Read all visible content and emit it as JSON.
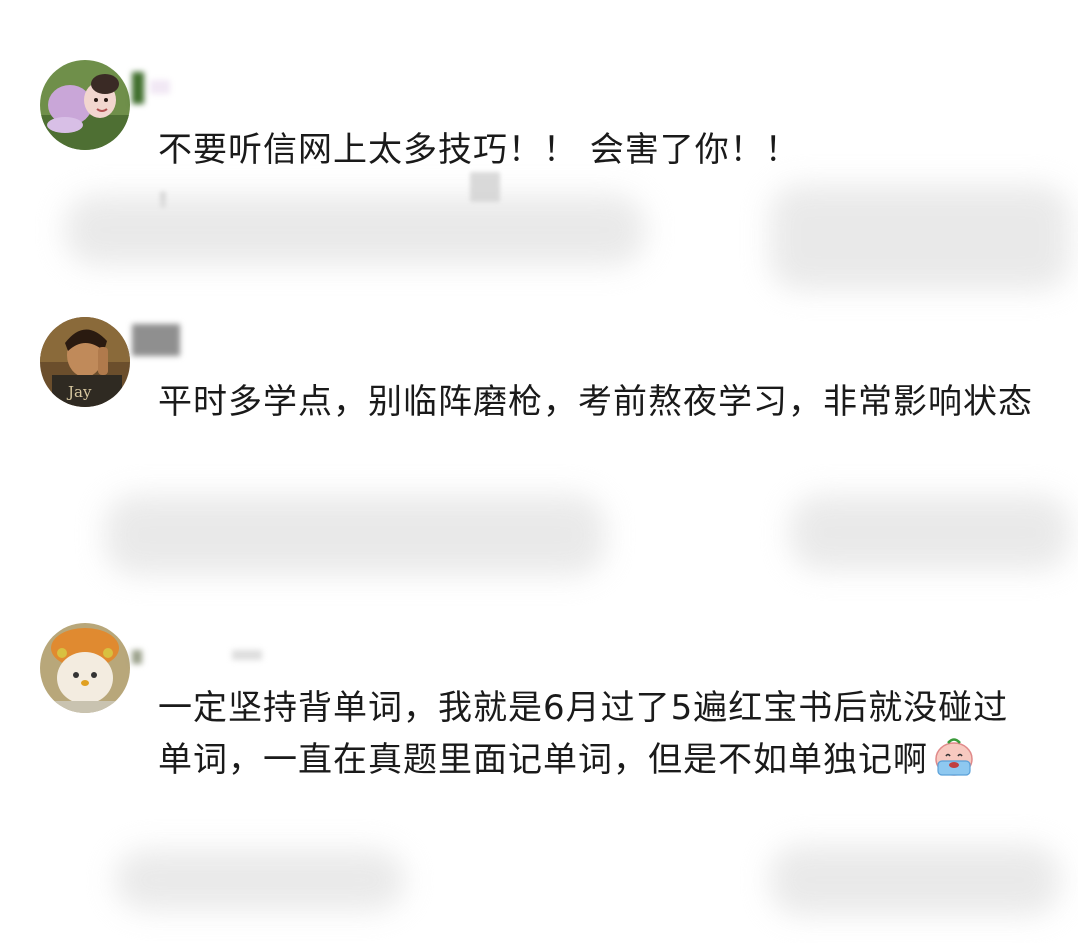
{
  "comments": [
    {
      "avatar_icon": "girl-portrait-avatar-icon",
      "text": "不要听信网上太多技巧！！ 会害了你！！"
    },
    {
      "avatar_icon": "boy-portrait-avatar-icon",
      "avatar_label": "Jay",
      "text": "平时多学点，别临阵磨枪，考前熬夜学习，非常影响状态"
    },
    {
      "avatar_icon": "cartoon-character-avatar-icon",
      "text": "一定坚持背单词，我就是6月过了5遍红宝书后就没碰过单词，一直在真题里面记单词，但是不如单独记啊",
      "emoji": "crying-face-emoji-icon"
    }
  ],
  "colors": {
    "text": "#1a1a1a",
    "background": "#ffffff",
    "redaction": "#e6e6e6"
  }
}
